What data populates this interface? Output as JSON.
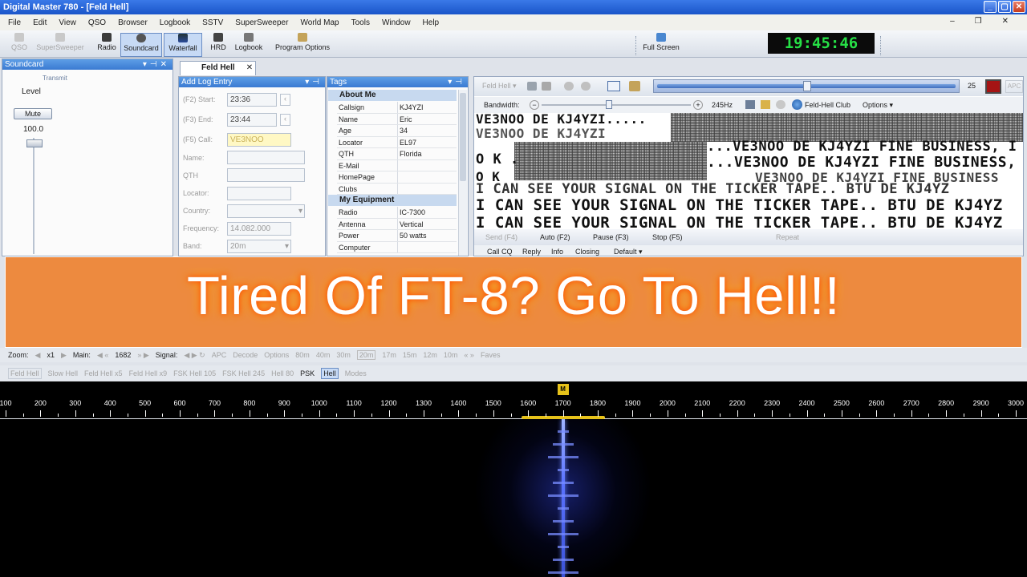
{
  "window": {
    "title": "Digital Master 780 - [Feld Hell]",
    "min": "_",
    "max": "▢",
    "close": "✕"
  },
  "menu": [
    "File",
    "Edit",
    "View",
    "QSO",
    "Browser",
    "Logbook",
    "SSTV",
    "SuperSweeper",
    "World Map",
    "Tools",
    "Window",
    "Help"
  ],
  "toolbar": {
    "qso": "QSO",
    "supersweeper": "SuperSweeper",
    "radio": "Radio",
    "soundcard": "Soundcard",
    "waterfall": "Waterfall",
    "hrd": "HRD",
    "logbook": "Logbook",
    "program_options": "Program Options",
    "full_screen": "Full Screen",
    "clock": "19:45:46"
  },
  "soundcard": {
    "title": "Soundcard",
    "transmit": "Transmit",
    "level": "Level",
    "mute": "Mute",
    "value": "100.0"
  },
  "tab": {
    "label": "Feld Hell",
    "close": "✕"
  },
  "log_entry": {
    "title": "Add Log Entry",
    "start_label": "(F2) Start:",
    "start_value": "23:36",
    "end_label": "(F3) End:",
    "end_value": "23:44",
    "call_label": "(F5) Call:",
    "call_value": "VE3NOO",
    "name_label": "Name:",
    "qth_label": "QTH",
    "locator_label": "Locator:",
    "country_label": "Country:",
    "frequency_label": "Frequency:",
    "frequency_value": "14.082.000",
    "band_label": "Band:",
    "band_value": "20m"
  },
  "tags": {
    "title": "Tags",
    "about_me": "About Me",
    "about": [
      [
        "Callsign",
        "KJ4YZI"
      ],
      [
        "Name",
        "Eric"
      ],
      [
        "Age",
        "34"
      ],
      [
        "Locator",
        "EL97"
      ],
      [
        "QTH",
        "Florida"
      ],
      [
        "E-Mail",
        ""
      ],
      [
        "HomePage",
        ""
      ],
      [
        "Clubs",
        ""
      ]
    ],
    "my_equipment": "My Equipment",
    "equipment": [
      [
        "Radio",
        "IC-7300"
      ],
      [
        "Antenna",
        "Vertical"
      ],
      [
        "Power",
        "50 watts"
      ],
      [
        "Computer",
        ""
      ]
    ]
  },
  "hell": {
    "mode_select": "Feld Hell",
    "level_value": "25",
    "apc": "APC",
    "bandwidth_label": "Bandwidth:",
    "bandwidth_value": "245Hz",
    "club": "Feld-Hell Club",
    "options": "Options",
    "lines": [
      "VE3NOO DE KJ4YZI.....",
      "VE3NOO DE KJ4YZI",
      "O K ...",
      "...VE3NOO DE KJ4YZI FINE BUSINESS, I",
      "...VE3NOO DE KJ4YZI FINE BUSINESS, I",
      "O K",
      "VE3NOO DE KJ4YZI FINE BUSINESS",
      "I CAN SEE YOUR SIGNAL ON THE TICKER TAPE.. BTU DE KJ4YZ",
      "I CAN SEE YOUR SIGNAL ON THE TICKER TAPE.. BTU DE KJ4YZ",
      "I CAN SEE YOUR SIGNAL ON THE TICKER TAPE.. BTU DE KJ4YZ"
    ],
    "send": "Send",
    "send_key": "(F4)",
    "auto": "Auto",
    "auto_key": "(F2)",
    "pause": "Pause",
    "pause_key": "(F3)",
    "stop": "Stop",
    "stop_key": "(F5)",
    "repeat": "Repeat",
    "macros": [
      "Call CQ",
      "Reply",
      "Info",
      "Closing",
      "Default ▾"
    ]
  },
  "banner": {
    "text": "Tired Of FT-8? Go To Hell!!"
  },
  "status": {
    "zoom_label": "Zoom:",
    "zoom_value": "x1",
    "main_label": "Main:",
    "main_value": "1682",
    "signal_label": "Signal:",
    "apc": "APC",
    "decode": "Decode",
    "options": "Options",
    "bands": [
      "80m",
      "40m",
      "30m",
      "20m",
      "17m",
      "15m",
      "12m",
      "10m"
    ],
    "faves": "Faves"
  },
  "modes": [
    "Feld Hell",
    "Slow Hell",
    "Feld Hell x5",
    "Feld Hell x9",
    "FSK Hell 105",
    "FSK Hell 245",
    "Hell 80",
    "PSK",
    "Hell",
    "Modes"
  ],
  "waterfall": {
    "marker": "M",
    "ticks": [
      "100",
      "200",
      "300",
      "400",
      "500",
      "600",
      "700",
      "800",
      "900",
      "1000",
      "1100",
      "1200",
      "1300",
      "1400",
      "1500",
      "1600",
      "1700",
      "1800",
      "1900",
      "2000",
      "2100",
      "2200",
      "2300",
      "2400",
      "2500",
      "2600",
      "2700",
      "2800",
      "2900",
      "3000"
    ],
    "signal_hz": 1700,
    "range_hz": [
      0,
      3000
    ],
    "passband_hz": [
      1580,
      1820
    ],
    "colors": {
      "marker": "#e6c21a",
      "signal": "#4f6bff"
    }
  }
}
